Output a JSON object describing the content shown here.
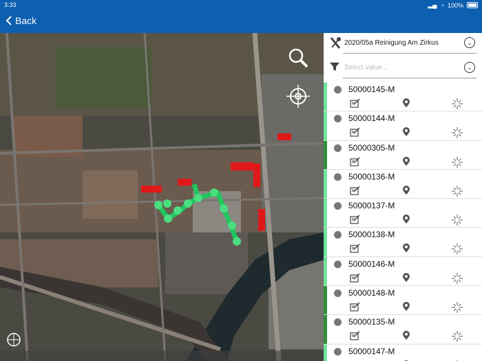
{
  "status": {
    "time": "3:33",
    "battery": "100%"
  },
  "nav": {
    "back_label": "Back"
  },
  "filters": {
    "project": {
      "value": "2020/05a Reinigung Am Zirkus"
    },
    "secondary": {
      "placeholder": "Select value..."
    }
  },
  "items": [
    {
      "code": "50000145-M",
      "bar_color": "#6fe59a"
    },
    {
      "code": "50000144-M",
      "bar_color": "#6fe59a"
    },
    {
      "code": "50000305-M",
      "bar_color": "#2f8f3a"
    },
    {
      "code": "50000136-M",
      "bar_color": "#6fe59a"
    },
    {
      "code": "50000137-M",
      "bar_color": "#6fe59a"
    },
    {
      "code": "50000138-M",
      "bar_color": "#6fe59a"
    },
    {
      "code": "50000146-M",
      "bar_color": "#6fe59a"
    },
    {
      "code": "50000148-M",
      "bar_color": "#2f8f3a"
    },
    {
      "code": "50000135-M",
      "bar_color": "#2f8f3a"
    },
    {
      "code": "50000147-M",
      "bar_color": "#6fe59a"
    }
  ]
}
